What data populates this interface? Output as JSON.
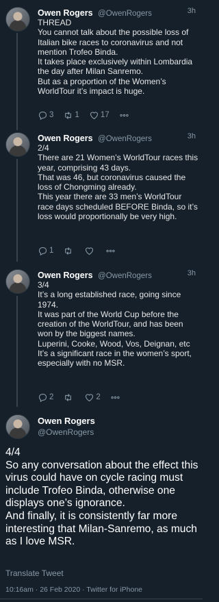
{
  "tweets": [
    {
      "name": "Owen Rogers",
      "handle": "@OwenRogers",
      "time": "3h",
      "text": "THREAD\nYou cannot talk about the possible loss of Italian bike races to coronavirus and not mention Trofeo Binda.\nIt takes place exclusively within Lombardia the day after Milan Sanremo.\nBut as a proportion of the Women’s WorldTour it’s impact is huge.",
      "replies": "3",
      "retweets": "1",
      "likes": "17"
    },
    {
      "name": "Owen Rogers",
      "handle": "@OwenRogers",
      "time": "3h",
      "text": "2/4\nThere are 21 Women’s WorldTour races this year, comprising 43 days.\nThat was 46, but coronavirus caused the loss of Chongming already.\nThis year there are 33 men’s WorldTour race days scheduled BEFORE Binda, so it’s loss would proportionally be very high.",
      "replies": "1",
      "retweets": "",
      "likes": ""
    },
    {
      "name": "Owen Rogers",
      "handle": "@OwenRogers",
      "time": "3h",
      "text": "3/4\nIt’s a long established race, going since 1974.\nIt was part of the World Cup before the creation of the WorldTour, and has been won by the biggest names.\nLuperini, Cooke, Wood, Vos, Deignan, etc\nIt’s a significant race in the women’s sport, especially with no MSR.",
      "replies": "2",
      "retweets": "",
      "likes": "2"
    }
  ],
  "main_tweet": {
    "name": "Owen Rogers",
    "handle": "@OwenRogers",
    "text": "4/4\nSo any conversation about the effect this virus could have on cycle racing must include Trofeo Binda, otherwise one displays one’s ignorance.\nAnd finally, it is consistently far more interesting that Milan-Sanremo, as much as I love MSR.",
    "translate_label": "Translate Tweet",
    "meta": "10:16am · 26 Feb 2020 · Twitter for iPhone"
  },
  "icons": {
    "reply": "reply-icon",
    "retweet": "retweet-icon",
    "like": "heart-icon",
    "more": "more-icon"
  }
}
